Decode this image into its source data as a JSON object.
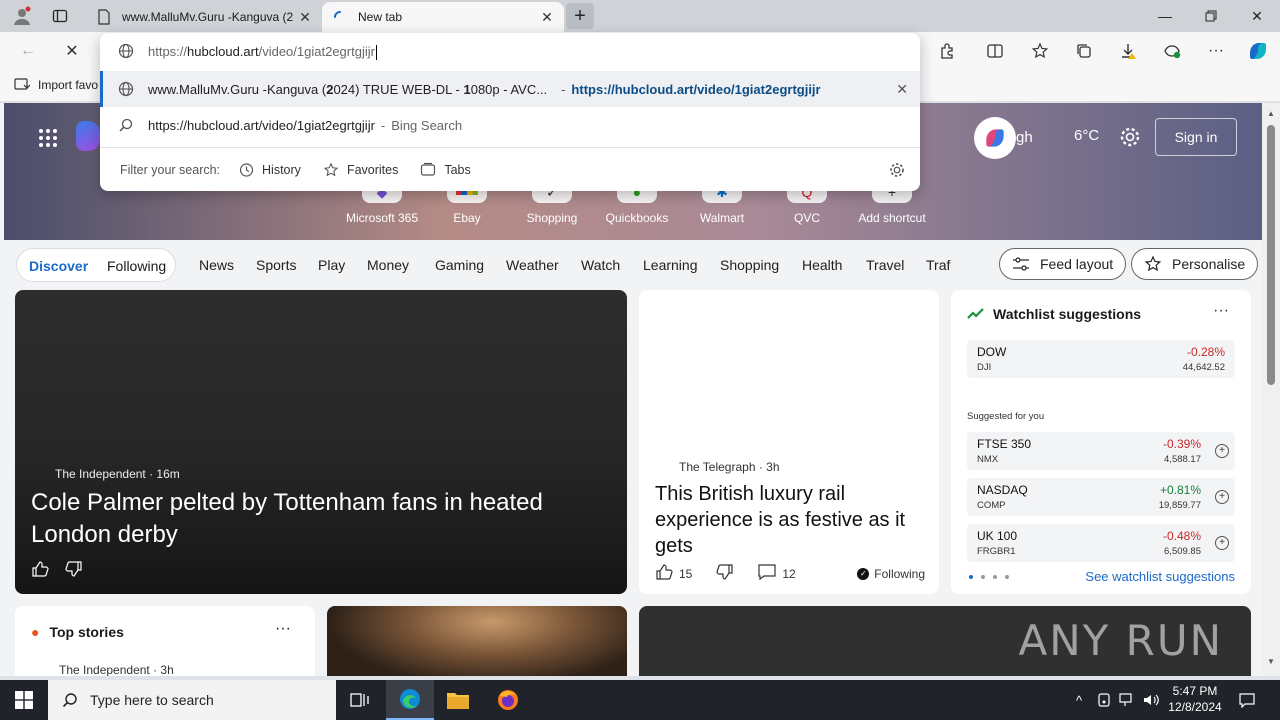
{
  "browser": {
    "tabs": [
      {
        "title": "www.MalluMv.Guru -Kanguva (2",
        "active": false
      },
      {
        "title": "New tab",
        "active": true
      }
    ],
    "address": {
      "typed": "https://hubcloud.art/video/1giat2egrtgjijr",
      "typed_domain": "hubcloud.art",
      "typed_prefix": "https://",
      "typed_path": "/video/1giat2egrtgjijr"
    },
    "suggestions": [
      {
        "text_pre": "www.MalluMv.Guru -Kanguva (",
        "text_b1": "2",
        "text_mid": "024) TRUE WEB-DL - ",
        "text_b2": "1",
        "text_post": "080p - AVC...",
        "sep": "-",
        "url": "https://hubcloud.art/video/1giat2egrtgjijr"
      },
      {
        "text": "https://hubcloud.art/video/1giat2egrtgjijr",
        "sep": "-",
        "engine": "Bing Search"
      }
    ],
    "filter": {
      "label": "Filter your search:",
      "history": "History",
      "favorites": "Favorites",
      "tabs": "Tabs"
    },
    "favorites_bar": {
      "import": "Import favo"
    }
  },
  "page": {
    "weather_location": "gh",
    "temperature": "6°C",
    "signin": "Sign in",
    "shortcuts": [
      "Microsoft 365",
      "Ebay",
      "Shopping",
      "Quickbooks",
      "Walmart",
      "QVC",
      "Add shortcut"
    ],
    "nav": {
      "discover": "Discover",
      "following": "Following",
      "items": [
        "News",
        "Sports",
        "Play",
        "Money",
        "Gaming",
        "Weather",
        "Watch",
        "Learning",
        "Shopping",
        "Health",
        "Travel",
        "Traf"
      ],
      "feed_layout": "Feed layout",
      "personalise": "Personalise"
    },
    "main_story": {
      "source": "The Independent",
      "age": "16m",
      "headline": "Cole Palmer pelted by Tottenham fans in heated London derby"
    },
    "side_story": {
      "source": "The Telegraph",
      "age": "3h",
      "headline": "This British luxury rail experience is as festive as it gets",
      "likes": "15",
      "comments": "12",
      "following": "Following"
    },
    "watchlist": {
      "title": "Watchlist suggestions",
      "primary": {
        "symbol": "DOW",
        "exchange": "DJI",
        "change": "-0.28%",
        "price": "44,642.52"
      },
      "suggested_label": "Suggested for you",
      "suggested": [
        {
          "symbol": "FTSE 350",
          "exchange": "NMX",
          "change": "-0.39%",
          "price": "4,588.17",
          "dir": "neg"
        },
        {
          "symbol": "NASDAQ",
          "exchange": "COMP",
          "change": "+0.81%",
          "price": "19,859.77",
          "dir": "pos"
        },
        {
          "symbol": "UK 100",
          "exchange": "FRGBR1",
          "change": "-0.48%",
          "price": "6,509.85",
          "dir": "neg"
        }
      ],
      "see_all": "See watchlist suggestions"
    },
    "top_stories": {
      "title": "Top stories",
      "source": "The Independent",
      "age": "3h"
    },
    "watermark": "ANY RUN"
  },
  "taskbar": {
    "search_placeholder": "Type here to search",
    "time": "5:47 PM",
    "date": "12/8/2024"
  }
}
